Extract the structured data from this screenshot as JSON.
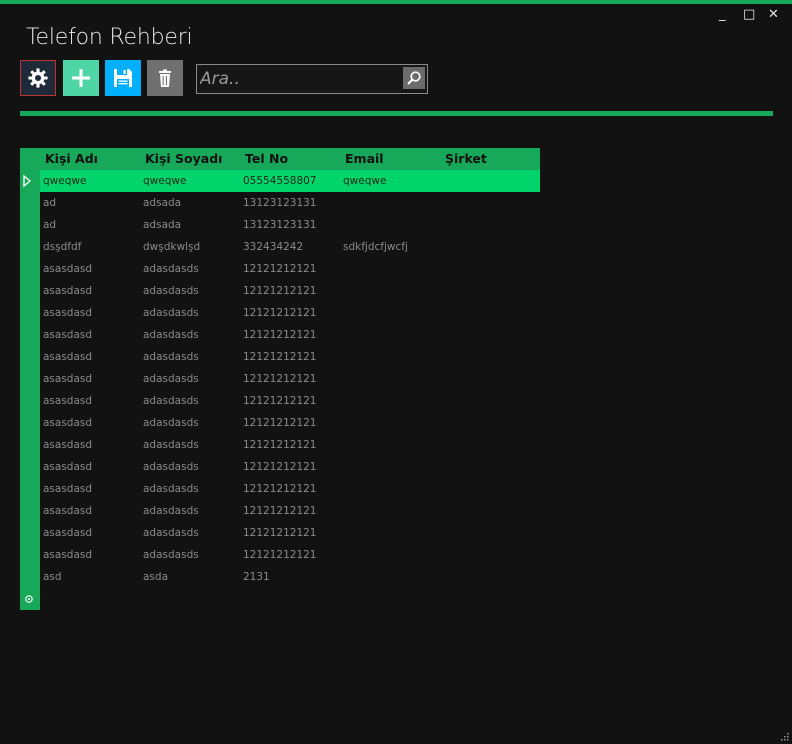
{
  "window": {
    "title": "Telefon Rehberi",
    "minimize": "_",
    "maximize": "□",
    "close": "✕"
  },
  "toolbar": {
    "settings_icon": "gear-icon",
    "add_icon": "plus-icon",
    "save_icon": "floppy-disk-icon",
    "delete_icon": "trash-icon",
    "colors": {
      "settings": "#1f2a38",
      "add": "#4fd6a6",
      "save": "#00b0ff",
      "delete": "#707070"
    }
  },
  "search": {
    "placeholder": "Ara..",
    "value": "",
    "icon": "search-icon"
  },
  "grid": {
    "columns": [
      "Kişi Adı",
      "Kişi Soyadı",
      "Tel No",
      "Email",
      "Şirket"
    ],
    "selected_row": 0,
    "rows": [
      [
        "qweqwe",
        "qweqwe",
        "05554558807",
        "qweqwe",
        ""
      ],
      [
        "ad",
        "adsada",
        "13123123131",
        "",
        ""
      ],
      [
        "ad",
        "adsada",
        "13123123131",
        "",
        ""
      ],
      [
        "dsşdfdf",
        "dwşdkwlşd",
        "332434242",
        "sdkfjdcfjwcfj",
        ""
      ],
      [
        "asasdasd",
        "adasdasds",
        "12121212121",
        "",
        ""
      ],
      [
        "asasdasd",
        "adasdasds",
        "12121212121",
        "",
        ""
      ],
      [
        "asasdasd",
        "adasdasds",
        "12121212121",
        "",
        ""
      ],
      [
        "asasdasd",
        "adasdasds",
        "12121212121",
        "",
        ""
      ],
      [
        "asasdasd",
        "adasdasds",
        "12121212121",
        "",
        ""
      ],
      [
        "asasdasd",
        "adasdasds",
        "12121212121",
        "",
        ""
      ],
      [
        "asasdasd",
        "adasdasds",
        "12121212121",
        "",
        ""
      ],
      [
        "asasdasd",
        "adasdasds",
        "12121212121",
        "",
        ""
      ],
      [
        "asasdasd",
        "adasdasds",
        "12121212121",
        "",
        ""
      ],
      [
        "asasdasd",
        "adasdasds",
        "12121212121",
        "",
        ""
      ],
      [
        "asasdasd",
        "adasdasds",
        "12121212121",
        "",
        ""
      ],
      [
        "asasdasd",
        "adasdasds",
        "12121212121",
        "",
        ""
      ],
      [
        "asasdasd",
        "adasdasds",
        "12121212121",
        "",
        ""
      ],
      [
        "asasdasd",
        "adasdasds",
        "12121212121",
        "",
        ""
      ],
      [
        "asd",
        "asda",
        "2131",
        "",
        ""
      ],
      [
        "",
        "",
        "",
        "",
        ""
      ]
    ],
    "accent": "#17a85a",
    "selected_color": "#00d46a"
  }
}
